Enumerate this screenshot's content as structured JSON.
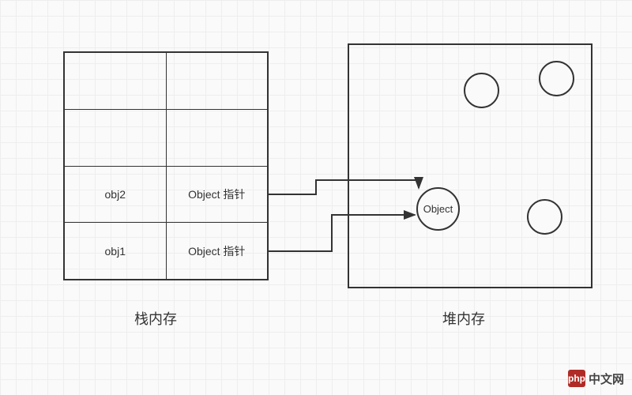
{
  "stack": {
    "label": "栈内存",
    "rows": [
      {
        "name": "",
        "pointer": ""
      },
      {
        "name": "",
        "pointer": ""
      },
      {
        "name": "obj2",
        "pointer": "Object 指针"
      },
      {
        "name": "obj1",
        "pointer": "Object 指针"
      }
    ]
  },
  "heap": {
    "label": "堆内存",
    "object_label": "Object"
  },
  "watermark": {
    "logo": "php",
    "text": "中文网"
  }
}
